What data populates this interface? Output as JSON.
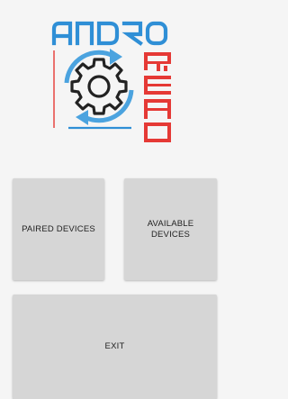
{
  "logo": {
    "wordmark_top": "ANDRO",
    "wordmark_side": "READ",
    "brand_blue": "#2F8FD6",
    "brand_red": "#E53935",
    "icon": "gear-sync-icon"
  },
  "buttons": {
    "paired_devices": "PAIRED DEVICES",
    "available_devices_line1": "AVAILABLE",
    "available_devices_line2": "DEVICES",
    "exit": "EXIT"
  }
}
